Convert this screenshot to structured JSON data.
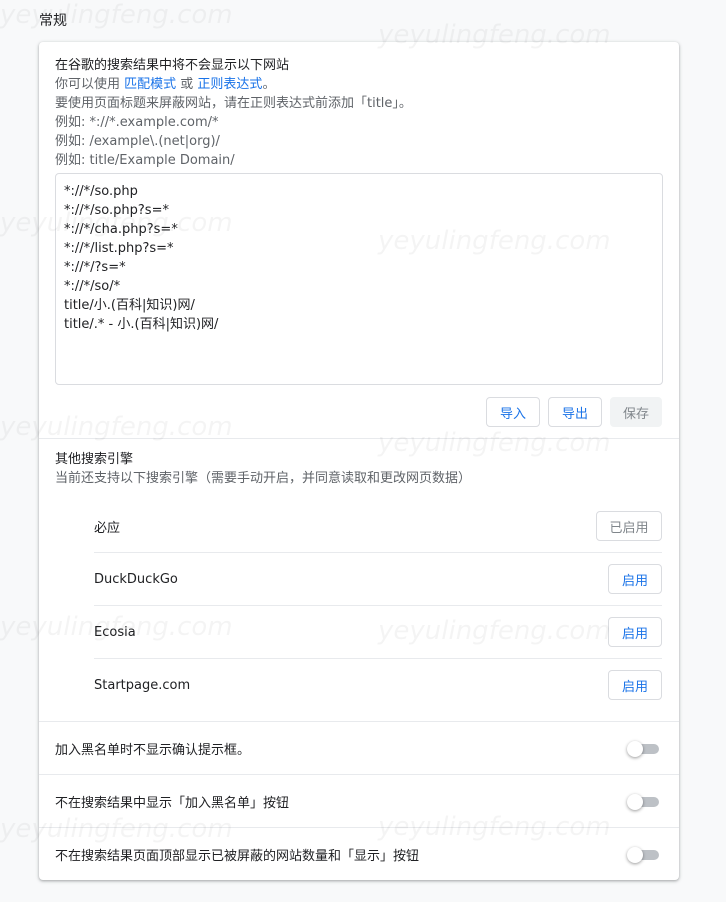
{
  "section": {
    "title": "常规"
  },
  "watermark": "yeyulingfeng.com",
  "intro": {
    "line1": "在谷歌的搜索结果中将不会显示以下网站",
    "line2_pre": "你可以使用 ",
    "match_link": "匹配模式",
    "line2_mid": " 或 ",
    "regex_link": "正则表达式",
    "line2_post": "。",
    "line3": "要使用页面标题来屏蔽网站，请在正则表达式前添加「title」。",
    "example1": "例如: *://*.example.com/*",
    "example2": "例如: /example\\.(net|org)/",
    "example3": "例如: title/Example Domain/"
  },
  "blocklist": {
    "value": "*://*/so.php\n*://*/so.php?s=*\n*://*/cha.php?s=*\n*://*/list.php?s=*\n*://*/?s=*\n*://*/so/*\ntitle/小.(百科|知识)网/\ntitle/.* - 小.(百科|知识)网/"
  },
  "actions": {
    "import_label": "导入",
    "export_label": "导出",
    "save_label": "保存"
  },
  "engines": {
    "title": "其他搜索引擎",
    "subtitle": "当前还支持以下搜索引擎（需要手动开启，并同意读取和更改网页数据）",
    "items": [
      {
        "name": "必应",
        "button": "已启用",
        "enabled": true
      },
      {
        "name": "DuckDuckGo",
        "button": "启用",
        "enabled": false
      },
      {
        "name": "Ecosia",
        "button": "启用",
        "enabled": false
      },
      {
        "name": "Startpage.com",
        "button": "启用",
        "enabled": false
      }
    ]
  },
  "toggles": [
    {
      "label": "加入黑名单时不显示确认提示框。",
      "on": false
    },
    {
      "label": "不在搜索结果中显示「加入黑名单」按钮",
      "on": false
    },
    {
      "label": "不在搜索结果页面顶部显示已被屏蔽的网站数量和「显示」按钮",
      "on": false
    }
  ],
  "colors": {
    "accent": "#1a73e8",
    "text": "#202124",
    "secondary": "#5f6368",
    "toggle_off": "#bdc1c6"
  }
}
